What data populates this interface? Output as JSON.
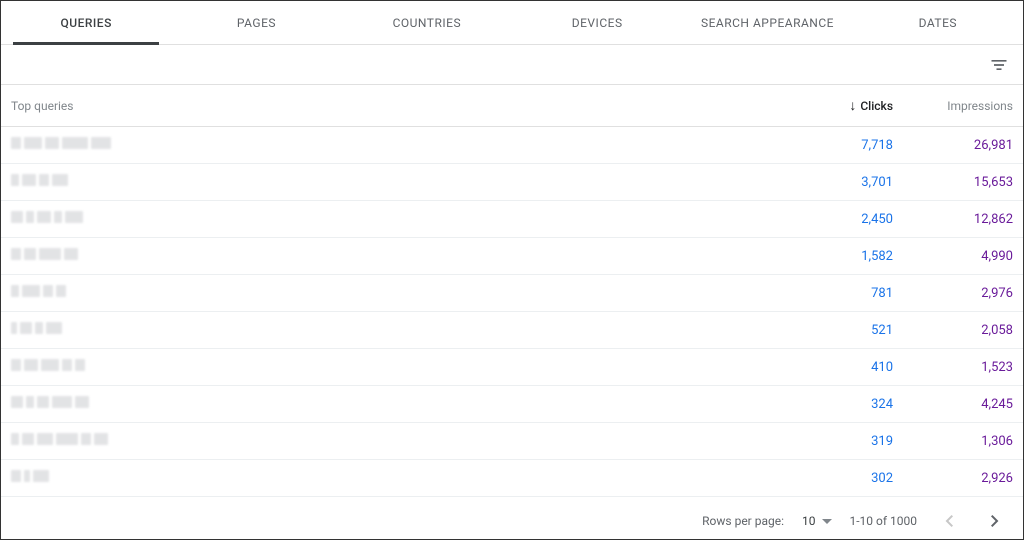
{
  "tabs": {
    "items": [
      "QUERIES",
      "PAGES",
      "COUNTRIES",
      "DEVICES",
      "SEARCH APPEARANCE",
      "DATES"
    ],
    "active_index": 0
  },
  "columns": {
    "query_label": "Top queries",
    "clicks_label": "Clicks",
    "impressions_label": "Impressions"
  },
  "sort": {
    "column": "Clicks",
    "direction": "desc"
  },
  "rows": [
    {
      "clicks": "7,718",
      "impressions": "26,981",
      "blur_widths": [
        10,
        18,
        14,
        26,
        20
      ]
    },
    {
      "clicks": "3,701",
      "impressions": "15,653",
      "blur_widths": [
        8,
        14,
        10,
        16
      ]
    },
    {
      "clicks": "2,450",
      "impressions": "12,862",
      "blur_widths": [
        12,
        8,
        14,
        8,
        18
      ]
    },
    {
      "clicks": "1,582",
      "impressions": "4,990",
      "blur_widths": [
        10,
        12,
        22,
        14
      ]
    },
    {
      "clicks": "781",
      "impressions": "2,976",
      "blur_widths": [
        8,
        18,
        10,
        10
      ]
    },
    {
      "clicks": "521",
      "impressions": "2,058",
      "blur_widths": [
        6,
        12,
        8,
        16
      ]
    },
    {
      "clicks": "410",
      "impressions": "1,523",
      "blur_widths": [
        10,
        14,
        18,
        10,
        10
      ]
    },
    {
      "clicks": "324",
      "impressions": "4,245",
      "blur_widths": [
        12,
        8,
        12,
        20,
        14
      ]
    },
    {
      "clicks": "319",
      "impressions": "1,306",
      "blur_widths": [
        8,
        12,
        16,
        22,
        10,
        14
      ]
    },
    {
      "clicks": "302",
      "impressions": "2,926",
      "blur_widths": [
        10,
        6,
        16
      ]
    }
  ],
  "pagination": {
    "rows_per_page_label": "Rows per page:",
    "rows_per_page_value": "10",
    "range_text": "1-10 of 1000",
    "prev_disabled": true,
    "next_disabled": false
  }
}
